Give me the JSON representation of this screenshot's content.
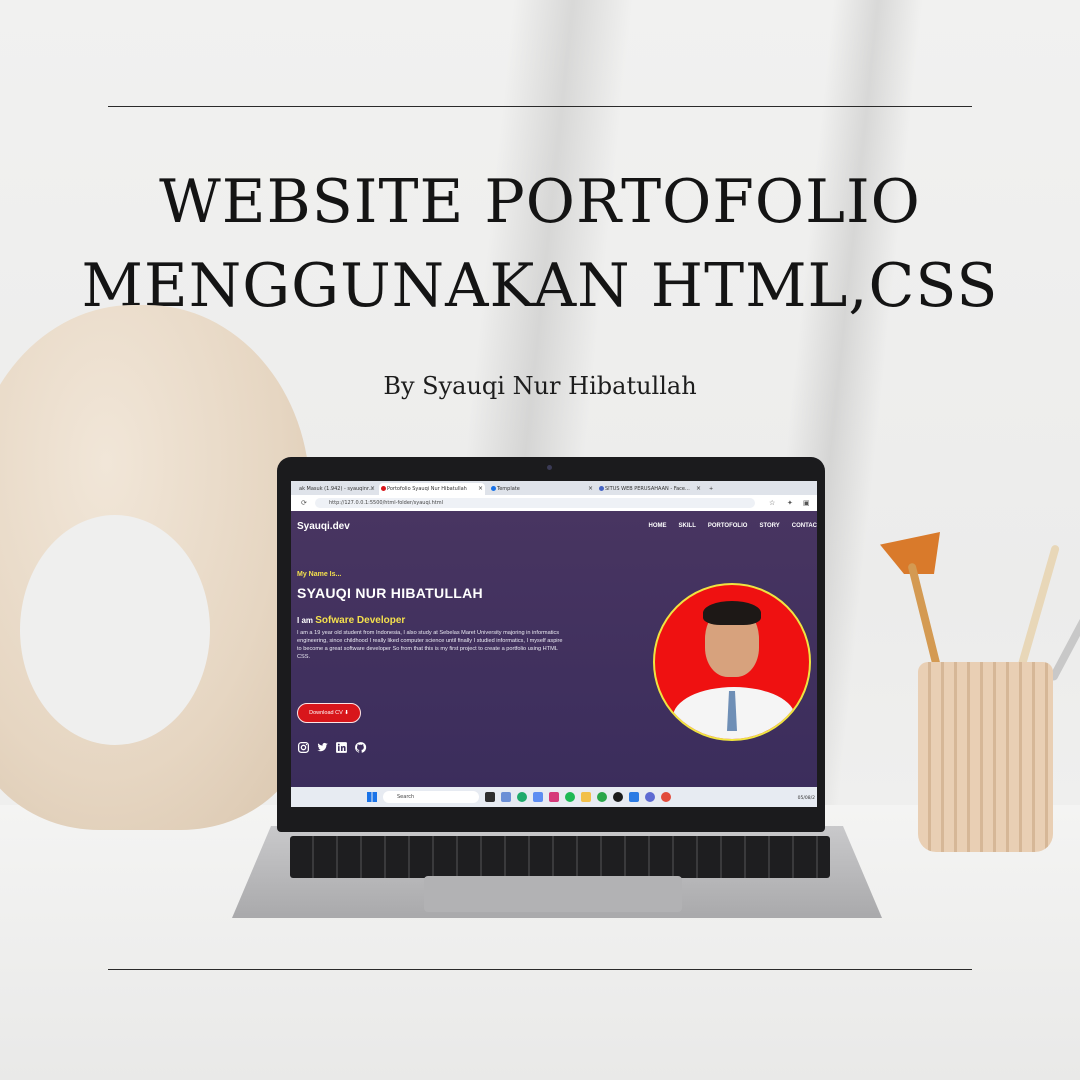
{
  "poster": {
    "title_line1": "WEBSITE PORTOFOLIO",
    "title_line2": "MENGGUNAKAN HTML,CSS",
    "byline": "By Syauqi Nur Hibatullah"
  },
  "browser": {
    "tabs": [
      {
        "label": "ak Masuk (1.942) - syauqinr..."
      },
      {
        "label": "Portofolio Syauqi Nur Hibatullah",
        "active": true
      },
      {
        "label": "Template"
      },
      {
        "label": "SITUS WEB PERUSAHAAN - Face..."
      }
    ],
    "new_tab_glyph": "+",
    "url": "http://127.0.0.1:5500/html-folder/syauqi.html",
    "accent": "#1a73e8"
  },
  "site": {
    "logo": "Syauqi.dev",
    "nav": [
      "HOME",
      "SKILL",
      "PORTOFOLIO",
      "STORY",
      "CONTAC"
    ],
    "greeting": "My Name Is...",
    "name": "SYAUQI NUR HIBATULLAH",
    "role_prefix": "I am",
    "role": "Sofware Developer",
    "bio": "I am a 19 year old student from Indonesia, I also study at Sebelas Maret University majoring in informatics engineering, since childhood I really liked computer science until finally I studied informatics, I myself aspire to become a great software developer So from that this is my first project to create a portfolio using HTML CSS.",
    "cv_button": "Download CV ⬇",
    "socials": [
      "instagram-icon",
      "twitter-icon",
      "linkedin-icon",
      "github-icon"
    ],
    "colors": {
      "background": "#3d2f5f",
      "highlight": "#f4e04d",
      "button": "#d8161b",
      "photo_bg": "#ef1111"
    }
  },
  "taskbar": {
    "search_placeholder": "Search",
    "clock": "05/08/2"
  }
}
